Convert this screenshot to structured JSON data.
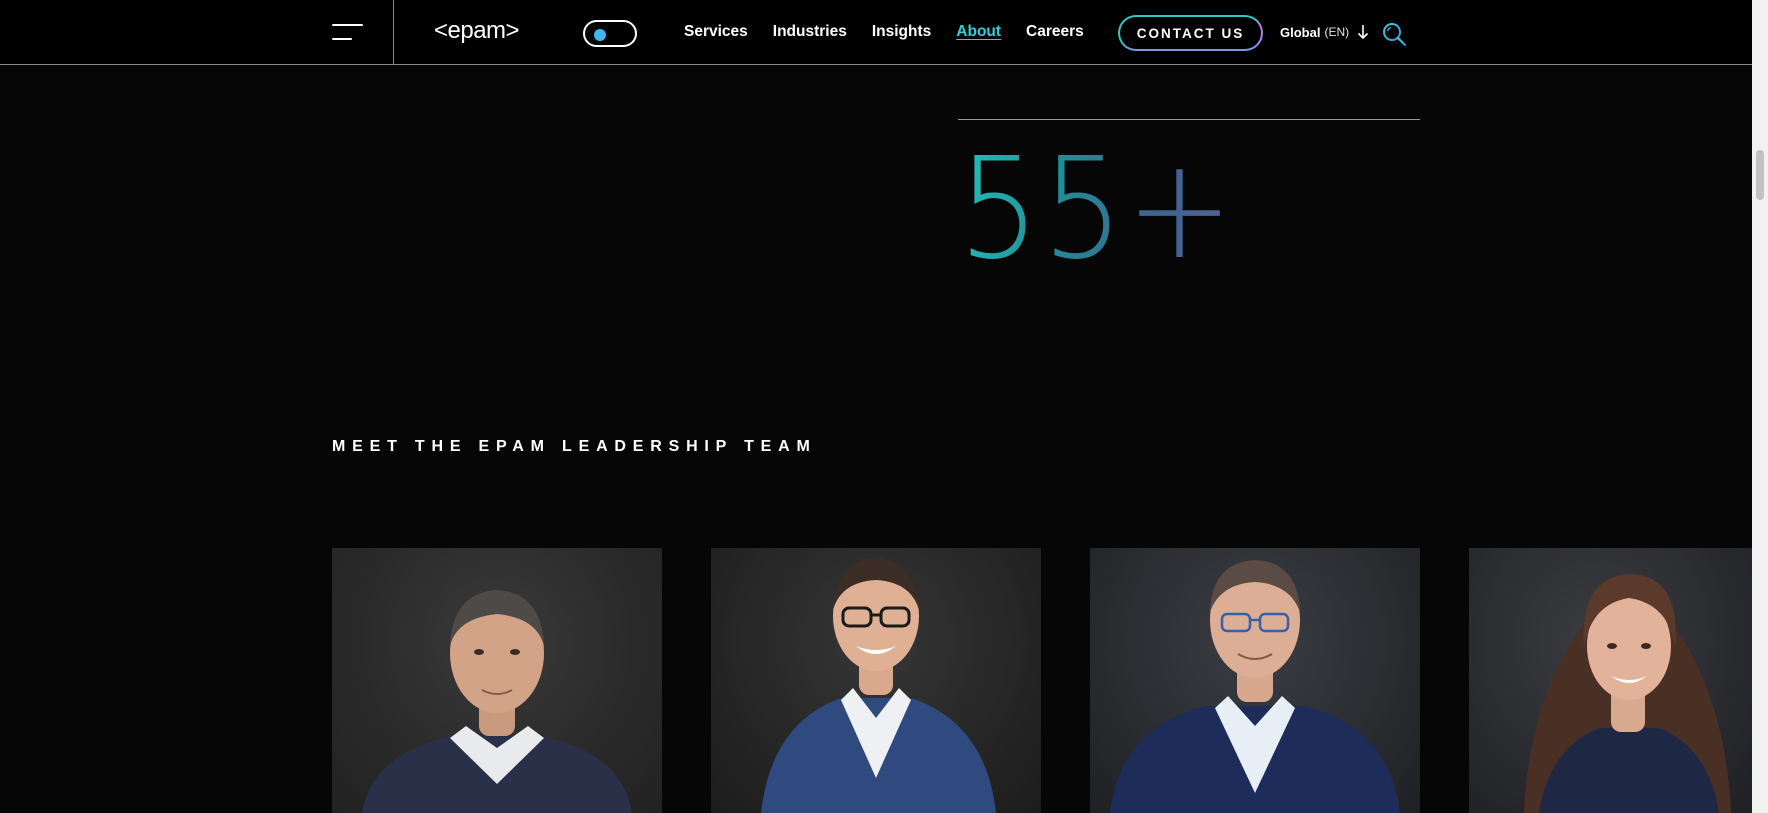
{
  "header": {
    "logo_text": "<epam>",
    "nav": [
      {
        "label": "Services"
      },
      {
        "label": "Industries"
      },
      {
        "label": "Insights"
      },
      {
        "label": "About",
        "active": true
      },
      {
        "label": "Careers"
      }
    ],
    "contact_label": "CONTACT US",
    "region_label": "Global",
    "language_label": "(EN)",
    "icons": {
      "menu": "hamburger-menu-icon",
      "theme": "theme-toggle-switch",
      "region": "arrow-down-icon",
      "search": "search-icon"
    }
  },
  "stat": {
    "value": "55+"
  },
  "leadership": {
    "title": "MEET THE EPAM LEADERSHIP TEAM"
  },
  "colors": {
    "background": "#060606",
    "accent_teal": "#2fd0d8",
    "toggle_knob": "#3fb7ec",
    "button_border_start": "#2fc6c4",
    "button_border_end": "#a885e8"
  }
}
